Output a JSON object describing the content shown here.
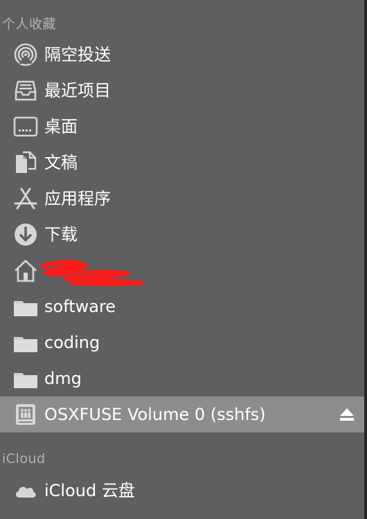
{
  "sections": {
    "favorites_header": "个人收藏",
    "icloud_header": "iCloud"
  },
  "favorites": [
    {
      "label": "隔空投送",
      "icon": "airdrop-icon"
    },
    {
      "label": "最近项目",
      "icon": "recents-icon"
    },
    {
      "label": "桌面",
      "icon": "desktop-icon"
    },
    {
      "label": "文稿",
      "icon": "documents-icon"
    },
    {
      "label": "应用程序",
      "icon": "applications-icon"
    },
    {
      "label": "下载",
      "icon": "downloads-icon"
    },
    {
      "label": "",
      "icon": "home-icon",
      "redacted": true
    },
    {
      "label": "software",
      "icon": "folder-icon"
    },
    {
      "label": "coding",
      "icon": "folder-icon"
    },
    {
      "label": "dmg",
      "icon": "folder-icon"
    },
    {
      "label": "OSXFUSE Volume 0 (sshfs)",
      "icon": "drive-icon",
      "selected": true,
      "ejectable": true
    }
  ],
  "icloud": [
    {
      "label": "iCloud 云盘",
      "icon": "cloud-icon"
    }
  ],
  "colors": {
    "background": "#5f5e60",
    "selected": "#8d8c8e",
    "header_text": "#b3b3b3",
    "icon": "#d6d6d6",
    "redaction": "#ff1a1a"
  }
}
